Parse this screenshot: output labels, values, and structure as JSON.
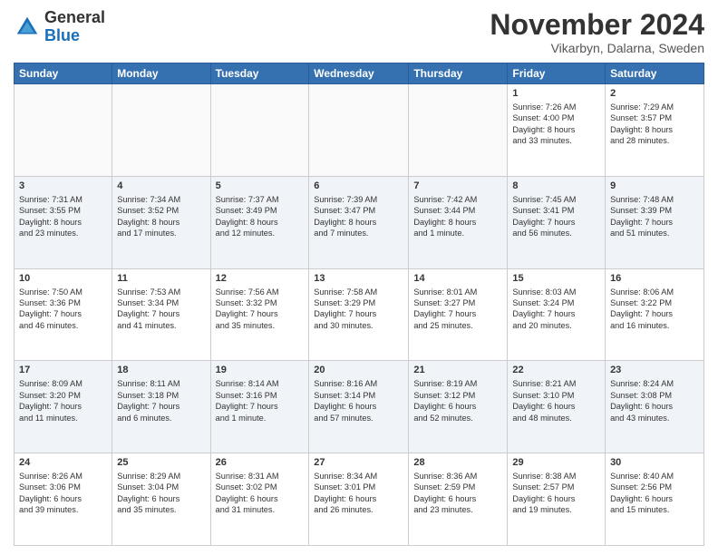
{
  "header": {
    "logo_line1": "General",
    "logo_line2": "Blue",
    "month_title": "November 2024",
    "subtitle": "Vikarbyn, Dalarna, Sweden"
  },
  "weekdays": [
    "Sunday",
    "Monday",
    "Tuesday",
    "Wednesday",
    "Thursday",
    "Friday",
    "Saturday"
  ],
  "weeks": [
    [
      {
        "day": "",
        "info": ""
      },
      {
        "day": "",
        "info": ""
      },
      {
        "day": "",
        "info": ""
      },
      {
        "day": "",
        "info": ""
      },
      {
        "day": "",
        "info": ""
      },
      {
        "day": "1",
        "info": "Sunrise: 7:26 AM\nSunset: 4:00 PM\nDaylight: 8 hours\nand 33 minutes."
      },
      {
        "day": "2",
        "info": "Sunrise: 7:29 AM\nSunset: 3:57 PM\nDaylight: 8 hours\nand 28 minutes."
      }
    ],
    [
      {
        "day": "3",
        "info": "Sunrise: 7:31 AM\nSunset: 3:55 PM\nDaylight: 8 hours\nand 23 minutes."
      },
      {
        "day": "4",
        "info": "Sunrise: 7:34 AM\nSunset: 3:52 PM\nDaylight: 8 hours\nand 17 minutes."
      },
      {
        "day": "5",
        "info": "Sunrise: 7:37 AM\nSunset: 3:49 PM\nDaylight: 8 hours\nand 12 minutes."
      },
      {
        "day": "6",
        "info": "Sunrise: 7:39 AM\nSunset: 3:47 PM\nDaylight: 8 hours\nand 7 minutes."
      },
      {
        "day": "7",
        "info": "Sunrise: 7:42 AM\nSunset: 3:44 PM\nDaylight: 8 hours\nand 1 minute."
      },
      {
        "day": "8",
        "info": "Sunrise: 7:45 AM\nSunset: 3:41 PM\nDaylight: 7 hours\nand 56 minutes."
      },
      {
        "day": "9",
        "info": "Sunrise: 7:48 AM\nSunset: 3:39 PM\nDaylight: 7 hours\nand 51 minutes."
      }
    ],
    [
      {
        "day": "10",
        "info": "Sunrise: 7:50 AM\nSunset: 3:36 PM\nDaylight: 7 hours\nand 46 minutes."
      },
      {
        "day": "11",
        "info": "Sunrise: 7:53 AM\nSunset: 3:34 PM\nDaylight: 7 hours\nand 41 minutes."
      },
      {
        "day": "12",
        "info": "Sunrise: 7:56 AM\nSunset: 3:32 PM\nDaylight: 7 hours\nand 35 minutes."
      },
      {
        "day": "13",
        "info": "Sunrise: 7:58 AM\nSunset: 3:29 PM\nDaylight: 7 hours\nand 30 minutes."
      },
      {
        "day": "14",
        "info": "Sunrise: 8:01 AM\nSunset: 3:27 PM\nDaylight: 7 hours\nand 25 minutes."
      },
      {
        "day": "15",
        "info": "Sunrise: 8:03 AM\nSunset: 3:24 PM\nDaylight: 7 hours\nand 20 minutes."
      },
      {
        "day": "16",
        "info": "Sunrise: 8:06 AM\nSunset: 3:22 PM\nDaylight: 7 hours\nand 16 minutes."
      }
    ],
    [
      {
        "day": "17",
        "info": "Sunrise: 8:09 AM\nSunset: 3:20 PM\nDaylight: 7 hours\nand 11 minutes."
      },
      {
        "day": "18",
        "info": "Sunrise: 8:11 AM\nSunset: 3:18 PM\nDaylight: 7 hours\nand 6 minutes."
      },
      {
        "day": "19",
        "info": "Sunrise: 8:14 AM\nSunset: 3:16 PM\nDaylight: 7 hours\nand 1 minute."
      },
      {
        "day": "20",
        "info": "Sunrise: 8:16 AM\nSunset: 3:14 PM\nDaylight: 6 hours\nand 57 minutes."
      },
      {
        "day": "21",
        "info": "Sunrise: 8:19 AM\nSunset: 3:12 PM\nDaylight: 6 hours\nand 52 minutes."
      },
      {
        "day": "22",
        "info": "Sunrise: 8:21 AM\nSunset: 3:10 PM\nDaylight: 6 hours\nand 48 minutes."
      },
      {
        "day": "23",
        "info": "Sunrise: 8:24 AM\nSunset: 3:08 PM\nDaylight: 6 hours\nand 43 minutes."
      }
    ],
    [
      {
        "day": "24",
        "info": "Sunrise: 8:26 AM\nSunset: 3:06 PM\nDaylight: 6 hours\nand 39 minutes."
      },
      {
        "day": "25",
        "info": "Sunrise: 8:29 AM\nSunset: 3:04 PM\nDaylight: 6 hours\nand 35 minutes."
      },
      {
        "day": "26",
        "info": "Sunrise: 8:31 AM\nSunset: 3:02 PM\nDaylight: 6 hours\nand 31 minutes."
      },
      {
        "day": "27",
        "info": "Sunrise: 8:34 AM\nSunset: 3:01 PM\nDaylight: 6 hours\nand 26 minutes."
      },
      {
        "day": "28",
        "info": "Sunrise: 8:36 AM\nSunset: 2:59 PM\nDaylight: 6 hours\nand 23 minutes."
      },
      {
        "day": "29",
        "info": "Sunrise: 8:38 AM\nSunset: 2:57 PM\nDaylight: 6 hours\nand 19 minutes."
      },
      {
        "day": "30",
        "info": "Sunrise: 8:40 AM\nSunset: 2:56 PM\nDaylight: 6 hours\nand 15 minutes."
      }
    ]
  ]
}
